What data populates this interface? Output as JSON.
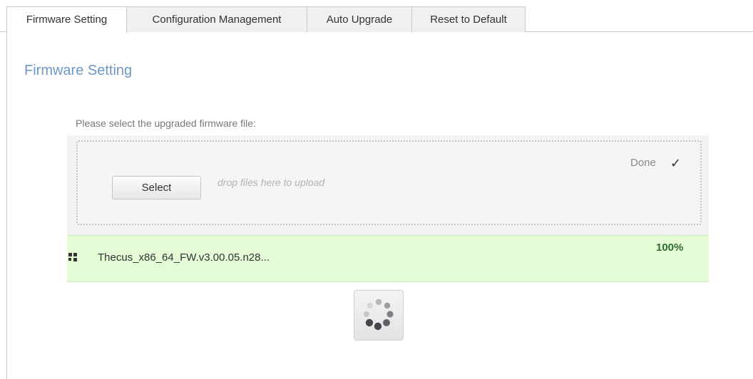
{
  "tabs": [
    {
      "label": "Firmware Setting",
      "active": true
    },
    {
      "label": "Configuration Management",
      "active": false
    },
    {
      "label": "Auto Upgrade",
      "active": false
    },
    {
      "label": "Reset to Default",
      "active": false
    }
  ],
  "page": {
    "title": "Firmware Setting",
    "instruction": "Please select the upgraded firmware file:"
  },
  "upload": {
    "select_label": "Select",
    "drop_hint": "drop files here to upload",
    "status_label": "Done",
    "status_icon": "check-icon",
    "file": {
      "name": "Thecus_x86_64_FW.v3.00.05.n28...",
      "progress_text": "100%",
      "progress": 1.0,
      "row_color": "#e4fdd6"
    }
  },
  "colors": {
    "title": "#6e97c4",
    "percent": "#2e6b2e"
  },
  "icons": {
    "drag_handle": "grip-icon",
    "loading": "spinner-icon"
  }
}
